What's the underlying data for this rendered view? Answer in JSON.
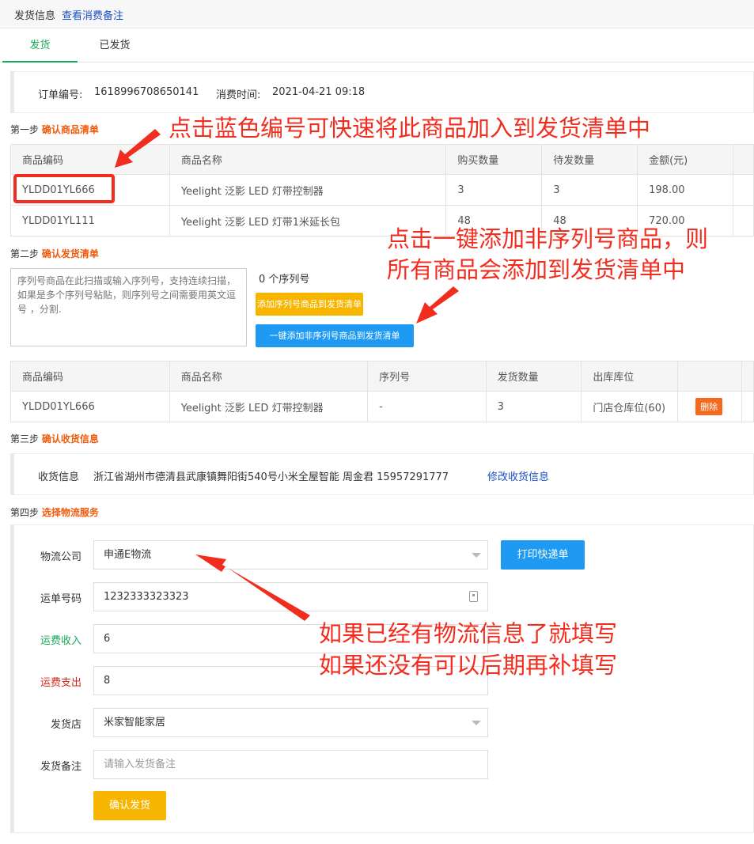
{
  "header": {
    "title": "发货信息",
    "link": "查看消费备注"
  },
  "tabs": [
    {
      "label": "发货"
    },
    {
      "label": "已发货"
    }
  ],
  "order": {
    "number_label": "订单编号:",
    "number": "1618996708650141",
    "time_label": "消费时间:",
    "time": "2021-04-21 09:18"
  },
  "step1": {
    "prefix": "第一步",
    "title": "确认商品清单"
  },
  "step2": {
    "prefix": "第二步",
    "title": "确认发货清单"
  },
  "step3": {
    "prefix": "第三步",
    "title": "确认收货信息"
  },
  "step4": {
    "prefix": "第四步",
    "title": "选择物流服务"
  },
  "products": {
    "headers": [
      "商品编码",
      "商品名称",
      "购买数量",
      "待发数量",
      "金额(元)"
    ],
    "rows": [
      {
        "code": "YLDD01YL666",
        "name": "Yeelight 泛影 LED 灯带控制器",
        "buy": "3",
        "pending": "3",
        "amount": "198.00"
      },
      {
        "code": "YLDD01YL111",
        "name": "Yeelight 泛影 LED 灯带1米延长包",
        "buy": "48",
        "pending": "48",
        "amount": "720.00"
      }
    ]
  },
  "serial": {
    "placeholder": "序列号商品在此扫描或输入序列号，支持连续扫描，如果是多个序列号粘贴，则序列号之间需要用英文逗号 ，分割.",
    "count_label": "0 个序列号",
    "add_serial_button": "添加序列号商品到发货清单",
    "add_nonserial_button": "一键添加非序列号商品到发货清单"
  },
  "shipping_list": {
    "headers": [
      "商品编码",
      "商品名称",
      "序列号",
      "发货数量",
      "出库库位"
    ],
    "rows": [
      {
        "code": "YLDD01YL666",
        "name": "Yeelight 泛影 LED 灯带控制器",
        "serial": "-",
        "qty": "3",
        "location": "门店仓库位(60)",
        "delete": "删除"
      }
    ]
  },
  "receiver": {
    "label": "收货信息",
    "value": "浙江省湖州市德清县武康镇舞阳街540号小米全屋智能 周金君 15957291777",
    "edit_link": "修改收货信息"
  },
  "logistics": {
    "company_label": "物流公司",
    "company": "申通E物流",
    "print_button": "打印快递单",
    "tracking_label": "运单号码",
    "tracking": "1232333323323",
    "income_label": "运费收入",
    "income": "6",
    "expense_label": "运费支出",
    "expense": "8",
    "store_label": "发货店",
    "store": "米家智能家居",
    "note_label": "发货备注",
    "note_placeholder": "请输入发货备注",
    "confirm_button": "确认发货"
  },
  "annotations": {
    "a1": "点击蓝色编号可快速将此商品加入到发货清单中",
    "a2_line1": "点击一键添加非序列号商品，则",
    "a2_line2": "所有商品会添加到发货清单中",
    "a3_line1": "如果已经有物流信息了就填写",
    "a3_line2": "如果还没有可以后期再补填写"
  },
  "colors": {
    "accent_green": "#16a95a",
    "step_orange": "#f05a0a",
    "link_blue": "#1a4fc8",
    "annotation_red": "#f02d1f",
    "button_yellow": "#f7b500",
    "button_blue": "#1e9af3"
  }
}
